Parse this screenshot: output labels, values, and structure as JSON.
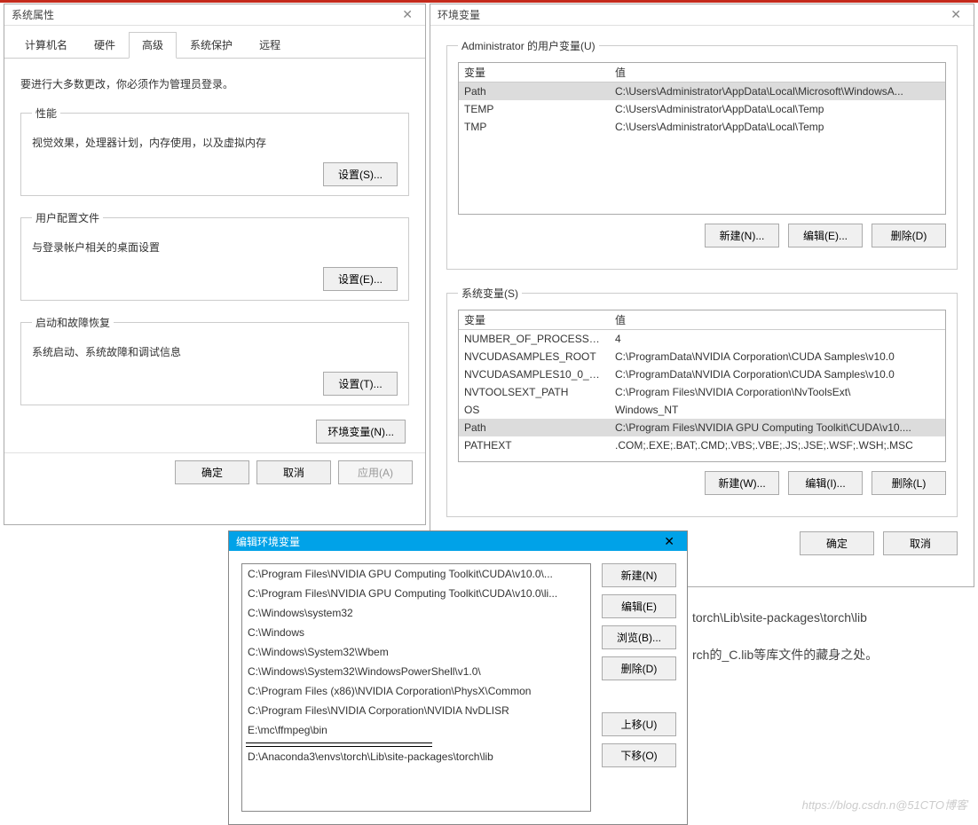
{
  "bg": {
    "line1": "torch\\Lib\\site-packages\\torch\\lib",
    "line2": "rch的_C.lib等库文件的藏身之处。"
  },
  "sysprops": {
    "title": "系统属性",
    "tabs": [
      "计算机名",
      "硬件",
      "高级",
      "系统保护",
      "远程"
    ],
    "activeTab": 2,
    "notice": "要进行大多数更改，你必须作为管理员登录。",
    "perf": {
      "legend": "性能",
      "desc": "视觉效果，处理器计划，内存使用，以及虚拟内存",
      "settings": "设置(S)..."
    },
    "profile": {
      "legend": "用户配置文件",
      "desc": "与登录帐户相关的桌面设置",
      "settings": "设置(E)..."
    },
    "startup": {
      "legend": "启动和故障恢复",
      "desc": "系统启动、系统故障和调试信息",
      "settings": "设置(T)..."
    },
    "envvars": "环境变量(N)...",
    "ok": "确定",
    "cancel": "取消",
    "apply": "应用(A)"
  },
  "envdlg": {
    "title": "环境变量",
    "userLabel": "Administrator 的用户变量(U)",
    "sysLabel": "系统变量(S)",
    "colVar": "变量",
    "colVal": "值",
    "userVars": [
      {
        "name": "Path",
        "value": "C:\\Users\\Administrator\\AppData\\Local\\Microsoft\\WindowsA...",
        "selected": true
      },
      {
        "name": "TEMP",
        "value": "C:\\Users\\Administrator\\AppData\\Local\\Temp"
      },
      {
        "name": "TMP",
        "value": "C:\\Users\\Administrator\\AppData\\Local\\Temp"
      }
    ],
    "sysVars": [
      {
        "name": "NUMBER_OF_PROCESSORS",
        "value": "4"
      },
      {
        "name": "NVCUDASAMPLES_ROOT",
        "value": "C:\\ProgramData\\NVIDIA Corporation\\CUDA Samples\\v10.0"
      },
      {
        "name": "NVCUDASAMPLES10_0_R...",
        "value": "C:\\ProgramData\\NVIDIA Corporation\\CUDA Samples\\v10.0"
      },
      {
        "name": "NVTOOLSEXT_PATH",
        "value": "C:\\Program Files\\NVIDIA Corporation\\NvToolsExt\\"
      },
      {
        "name": "OS",
        "value": "Windows_NT"
      },
      {
        "name": "Path",
        "value": "C:\\Program Files\\NVIDIA GPU Computing Toolkit\\CUDA\\v10....",
        "selected": true
      },
      {
        "name": "PATHEXT",
        "value": ".COM;.EXE;.BAT;.CMD;.VBS;.VBE;.JS;.JSE;.WSF;.WSH;.MSC"
      }
    ],
    "newBtnU": "新建(N)...",
    "editBtnU": "编辑(E)...",
    "delBtnU": "删除(D)",
    "newBtnS": "新建(W)...",
    "editBtnS": "编辑(I)...",
    "delBtnS": "删除(L)",
    "ok": "确定",
    "cancel": "取消"
  },
  "editpath": {
    "title": "编辑环境变量",
    "entries": [
      "C:\\Program Files\\NVIDIA GPU Computing Toolkit\\CUDA\\v10.0\\...",
      "C:\\Program Files\\NVIDIA GPU Computing Toolkit\\CUDA\\v10.0\\li...",
      "C:\\Windows\\system32",
      "C:\\Windows",
      "C:\\Windows\\System32\\Wbem",
      "C:\\Windows\\System32\\WindowsPowerShell\\v1.0\\",
      "C:\\Program Files (x86)\\NVIDIA Corporation\\PhysX\\Common",
      "C:\\Program Files\\NVIDIA Corporation\\NVIDIA NvDLISR",
      "E:\\mc\\ffmpeg\\bin",
      "",
      "",
      "D:\\Anaconda3\\envs\\torch\\Lib\\site-packages\\torch\\lib"
    ],
    "redactedIndices": [
      9,
      10
    ],
    "btns": {
      "newBtn": "新建(N)",
      "edit": "编辑(E)",
      "browse": "浏览(B)...",
      "del": "删除(D)",
      "up": "上移(U)",
      "down": "下移(O)"
    }
  },
  "watermark": "https://blog.csdn.n@51CTO博客"
}
